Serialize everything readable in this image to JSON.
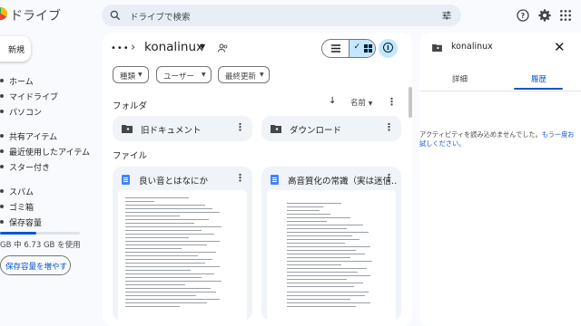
{
  "app": {
    "title": "ドライブ"
  },
  "search": {
    "placeholder": "ドライブで検索",
    "icon": "search-icon"
  },
  "header_icons": [
    "help-icon",
    "settings-icon",
    "apps-grid-icon"
  ],
  "sidebar": {
    "new_label": "新規",
    "items": [
      {
        "label": "ホーム",
        "icon": "home-icon"
      },
      {
        "label": "マイドライブ",
        "icon": "drive-icon"
      },
      {
        "label": "パソコン",
        "icon": "computer-icon"
      },
      {
        "label": "共有アイテム",
        "icon": "shared-icon"
      },
      {
        "label": "最近使用したアイテム",
        "icon": "recent-icon"
      },
      {
        "label": "スター付き",
        "icon": "star-icon"
      },
      {
        "label": "スパム",
        "icon": "spam-icon"
      },
      {
        "label": "ゴミ箱",
        "icon": "trash-icon"
      },
      {
        "label": "保存容量",
        "icon": "cloud-icon"
      }
    ],
    "storage": {
      "used_text": "GB 中 6.73 GB を使用",
      "fraction": 0.45
    },
    "buy_label": "保存容量を増やす"
  },
  "main": {
    "folder_name": "konalinux",
    "filters": [
      "種類",
      "ユーザー",
      "最終更新"
    ],
    "folders_heading": "フォルダ",
    "sort_label": "名前",
    "folders": [
      {
        "name": "旧ドキュメント"
      },
      {
        "name": "ダウンロード"
      }
    ],
    "files_heading": "ファイル",
    "files": [
      {
        "name": "良い音とはなにか"
      },
      {
        "name": "高音質化の常識（実は迷信…"
      }
    ]
  },
  "details_panel": {
    "title": "konalinux",
    "tabs": [
      "詳細",
      "履歴"
    ],
    "active_tab": "履歴",
    "message": "アクティビティを読み込めませんでした。",
    "retry_link": "もう一度お試しください。"
  },
  "colors": {
    "accent": "#0b57d0",
    "selected": "#c2e7ff",
    "card": "#f0f4f9",
    "bg": "#f8fafd"
  }
}
